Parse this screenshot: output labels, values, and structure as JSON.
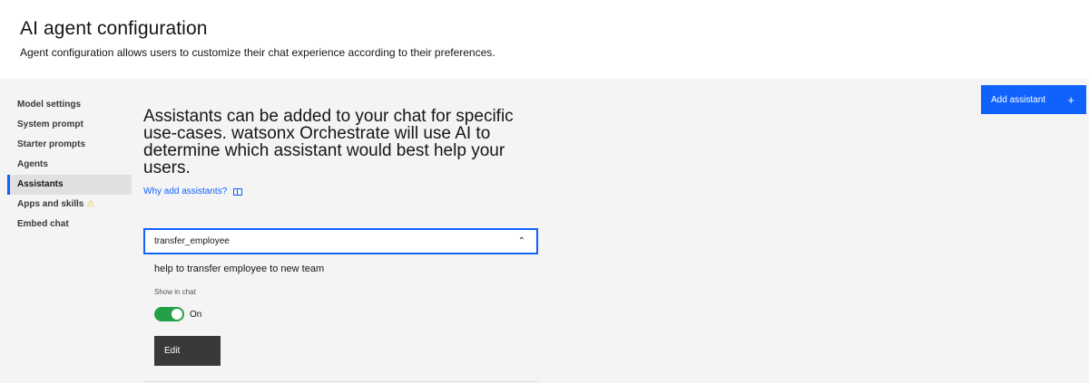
{
  "header": {
    "title": "AI agent configuration",
    "subtitle": "Agent configuration allows users to customize their chat experience according to their preferences."
  },
  "sidebar": {
    "items": [
      {
        "label": "Model settings"
      },
      {
        "label": "System prompt"
      },
      {
        "label": "Starter prompts"
      },
      {
        "label": "Agents"
      },
      {
        "label": "Assistants",
        "active": true
      },
      {
        "label": "Apps and skills",
        "warning": true
      },
      {
        "label": "Embed chat"
      }
    ]
  },
  "main": {
    "add_button_label": "Add assistant",
    "add_button_icon": "+",
    "hero_text": "Assistants can be added to your chat for specific use-cases. watsonx Orchestrate will use AI to determine which assistant would best help your users.",
    "why_link": "Why add assistants?",
    "assistant": {
      "name": "transfer_employee",
      "description": "help to transfer employee to new team",
      "show_in_chat_label": "Show in chat",
      "toggle_state": "On",
      "toggle_on": true,
      "edit_label": "Edit"
    }
  },
  "colors": {
    "accent": "#0f62fe",
    "toggle_on": "#24a148",
    "warning": "#f1c21b",
    "edit_button": "#393939"
  },
  "icons": {
    "add": "plus-icon",
    "warning": "warning-icon",
    "book": "book-icon",
    "chevron": "chevron-up-icon"
  }
}
